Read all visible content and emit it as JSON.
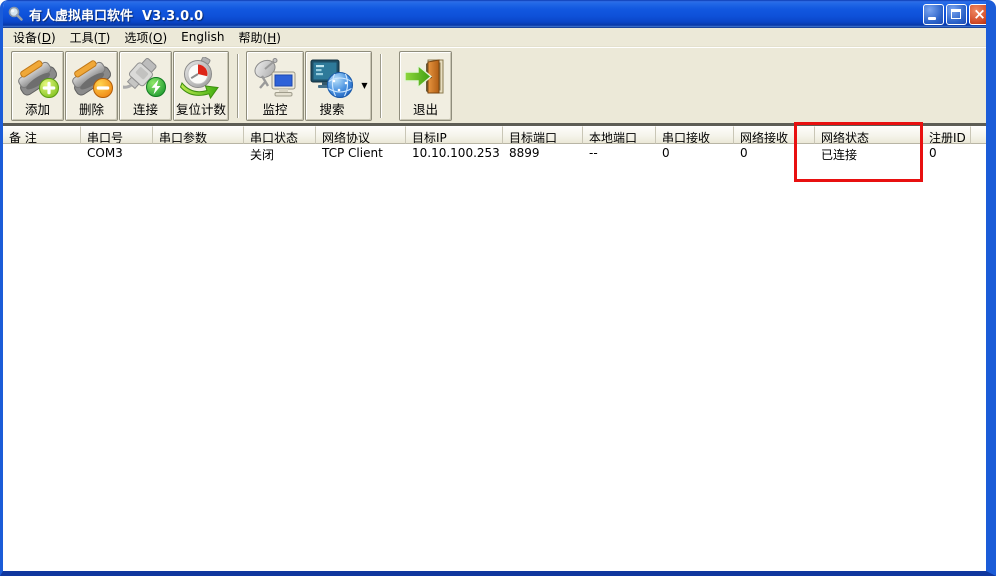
{
  "window": {
    "title": "有人虚拟串口软件  V3.3.0.0",
    "close_glyph": "×"
  },
  "menu": {
    "items": [
      {
        "pre": "设备(",
        "key": "D",
        "post": ")"
      },
      {
        "pre": "工具(",
        "key": "T",
        "post": ")"
      },
      {
        "pre": "选项(",
        "key": "O",
        "post": ")"
      },
      {
        "pre": "English",
        "key": "",
        "post": ""
      },
      {
        "pre": "帮助(",
        "key": "H",
        "post": ")"
      }
    ]
  },
  "toolbar": {
    "buttons": [
      {
        "label": "添加",
        "icon": "serial-connector-add"
      },
      {
        "label": "删除",
        "icon": "serial-connector-remove"
      },
      {
        "label": "连接",
        "icon": "plug-connect"
      },
      {
        "label": "复位计数",
        "icon": "stopwatch-reset"
      },
      {
        "label": "监控",
        "icon": "satellite-monitor"
      },
      {
        "label": "搜索",
        "icon": "network-search"
      },
      {
        "label": "退出",
        "icon": "exit-door"
      }
    ],
    "dropdown_glyph": "▼"
  },
  "table": {
    "columns": [
      {
        "label": "备 注"
      },
      {
        "label": "串口号"
      },
      {
        "label": "串口参数"
      },
      {
        "label": "串口状态"
      },
      {
        "label": "网络协议"
      },
      {
        "label": "目标IP"
      },
      {
        "label": "目标端口"
      },
      {
        "label": "本地端口"
      },
      {
        "label": "串口接收"
      },
      {
        "label": "网络接收"
      },
      {
        "label": ""
      },
      {
        "label": "网络状态"
      },
      {
        "label": "注册ID"
      },
      {
        "label": ""
      }
    ],
    "rows": [
      {
        "cells": [
          "",
          "COM3",
          "",
          "关闭",
          "TCP Client",
          "10.10.100.253",
          "8899",
          "--",
          "0",
          "0",
          "",
          "已连接",
          "0",
          ""
        ]
      }
    ]
  },
  "annotation": {
    "highlight_color": "#e81010"
  },
  "colors": {
    "titlebar_blue": "#1258e0",
    "window_border_blue": "#1b5cd8",
    "chrome_beige": "#ece9d8"
  }
}
